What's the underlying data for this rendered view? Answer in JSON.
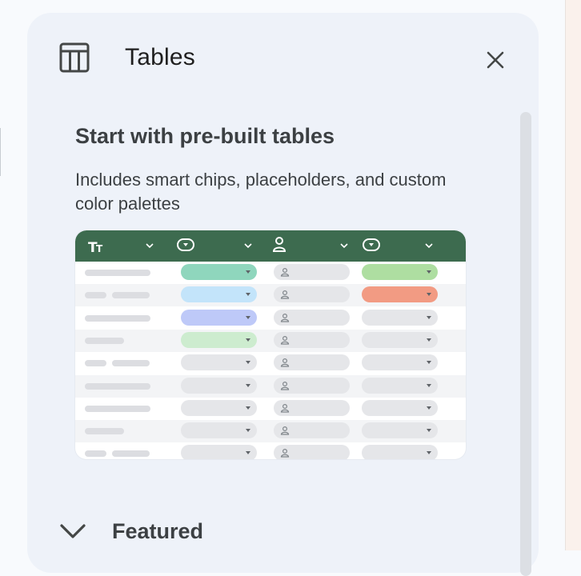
{
  "panel": {
    "title": "Tables",
    "title_icon": "table-icon",
    "close_icon": "close-icon"
  },
  "section": {
    "heading": "Start with pre-built tables",
    "description": "Includes smart chips, placeholders, and custom color palettes"
  },
  "preview": {
    "header_color": "#3d6b4f",
    "columns": [
      {
        "icon": "text-format-icon"
      },
      {
        "icon": "dropdown-chip-icon"
      },
      {
        "icon": "person-icon"
      },
      {
        "icon": "dropdown-chip-icon"
      }
    ],
    "rows": [
      {
        "col2": "#8fd6bd",
        "col4": "#aedea1"
      },
      {
        "col2": "#c3e4fa",
        "col4": "#f29b83"
      },
      {
        "col2": "#bec9f8",
        "col4": ""
      },
      {
        "col2": "#cdeccf",
        "col4": ""
      },
      {
        "col2": "",
        "col4": ""
      },
      {
        "col2": "",
        "col4": ""
      },
      {
        "col2": "",
        "col4": ""
      },
      {
        "col2": "",
        "col4": ""
      },
      {
        "col2": "",
        "col4": ""
      }
    ]
  },
  "featured": {
    "label": "Featured",
    "icon": "chevron-down-icon"
  }
}
